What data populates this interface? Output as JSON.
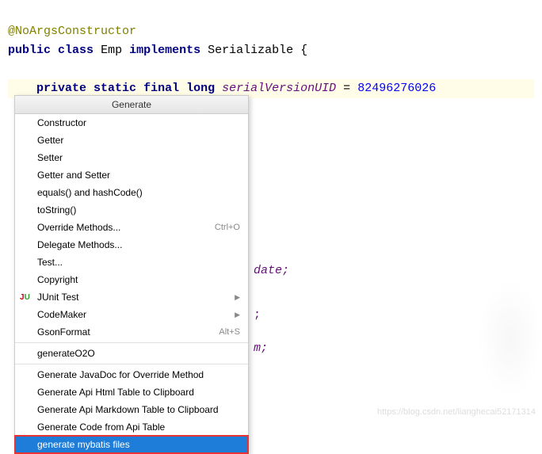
{
  "code": {
    "annotation": "@NoArgsConstructor",
    "line1_public": "public",
    "line1_class": "class",
    "line1_name": "Emp",
    "line1_implements": "implements",
    "line1_intf": "Serializable",
    "line1_brace": " {",
    "line2_private": "private",
    "line2_static": "static",
    "line2_final": "final",
    "line2_long": "long",
    "line2_field": "serialVersionUID",
    "line2_eq": " = ",
    "line2_num": "82496276026"
  },
  "bg_identifiers": {
    "a": "date;",
    "b": ";",
    "c": "m;"
  },
  "menu": {
    "title": "Generate",
    "items": [
      {
        "label": "Constructor"
      },
      {
        "label": "Getter"
      },
      {
        "label": "Setter"
      },
      {
        "label": "Getter and Setter"
      },
      {
        "label": "equals() and hashCode()"
      },
      {
        "label": "toString()"
      },
      {
        "label": "Override Methods...",
        "shortcut": "Ctrl+O"
      },
      {
        "label": "Delegate Methods..."
      },
      {
        "label": "Test..."
      },
      {
        "label": "Copyright"
      },
      {
        "label": "JUnit Test",
        "submenu": true,
        "icon": "junit"
      },
      {
        "label": "CodeMaker",
        "submenu": true
      },
      {
        "label": "GsonFormat",
        "shortcut": "Alt+S"
      },
      {
        "sep": true
      },
      {
        "label": "generateO2O"
      },
      {
        "sep": true
      },
      {
        "label": "Generate JavaDoc for Override Method"
      },
      {
        "label": "Generate Api Html Table to Clipboard"
      },
      {
        "label": "Generate Api Markdown Table to Clipboard"
      },
      {
        "label": "Generate Code from Api Table"
      },
      {
        "label": "generate mybatis files",
        "selected": true,
        "highlighted": true
      }
    ]
  },
  "watermark": "https://blog.csdn.net/lianghecai52171314"
}
